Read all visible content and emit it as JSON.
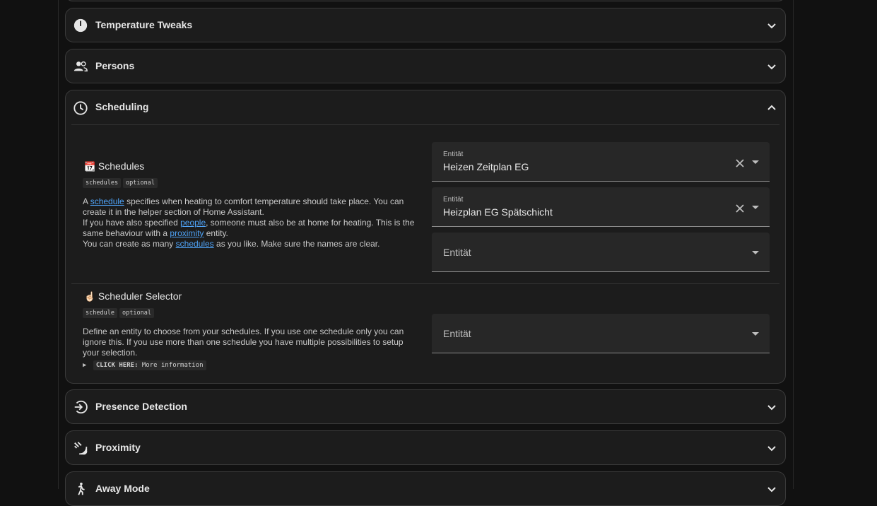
{
  "sections": {
    "temperature_tweaks": "Temperature Tweaks",
    "persons": "Persons",
    "scheduling": "Scheduling",
    "presence_detection": "Presence Detection",
    "proximity": "Proximity",
    "away_mode": "Away Mode"
  },
  "schedules": {
    "emoji": "📆",
    "title": "Schedules",
    "tag_key": "schedules",
    "tag_optional": "optional",
    "desc": {
      "l1_pre": "A ",
      "l1_link": "schedule",
      "l1_post": " specifies when heating to comfort temperature should take place. You can create it in the helper section of Home Assistant.",
      "l2_pre": "If you have also specified ",
      "l2_link": "people",
      "l2_mid": ", someone must also be at home for heating. This is the same behaviour with a ",
      "l2_link2": "proximity",
      "l2_post": " entity.",
      "l3_pre": "You can create as many ",
      "l3_link": "schedules",
      "l3_post": " as you like. Make sure the names are clear."
    },
    "fields": [
      {
        "label": "Entität",
        "value": "Heizen Zeitplan EG"
      },
      {
        "label": "Entität",
        "value": "Heizplan EG Spätschicht"
      },
      {
        "placeholder": "Entität"
      }
    ]
  },
  "scheduler_selector": {
    "emoji": "☝🏻",
    "title": "Scheduler Selector",
    "tag_key": "schedule",
    "tag_optional": "optional",
    "desc": "Define an entity to choose from your schedules. If you use one schedule only you can ignore this. If you use more than one schedule you have multiple possibilities to setup your selection.",
    "field_placeholder": "Entität",
    "more_arrow": "▶",
    "more_bold": "CLICK HERE:",
    "more_text": " More information"
  },
  "colors": {
    "link": "#4fa3f7",
    "panel": "#1c1c1c",
    "field": "#272727"
  }
}
